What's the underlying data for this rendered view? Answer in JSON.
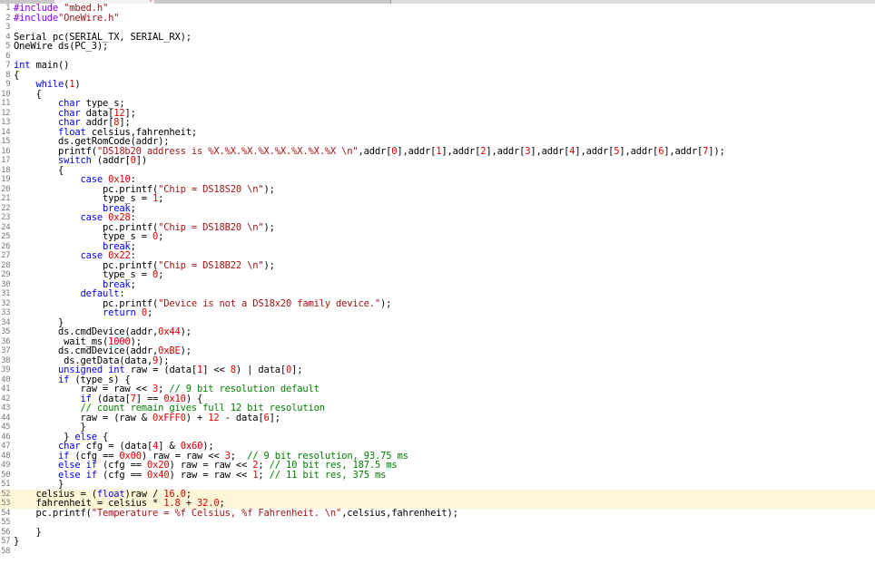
{
  "colors": {
    "keyword": "#0000ff",
    "string": "#a31515",
    "number": "#e00000",
    "comment": "#008000",
    "preprocessor": "#8000ff",
    "line_highlight": "#fff6d8",
    "line_number": "#7a7a7a"
  },
  "tabs": [
    {
      "label": "",
      "active": false
    },
    {
      "label": "",
      "active": true
    },
    {
      "label": "",
      "active": false
    },
    {
      "label": "",
      "active": false
    }
  ],
  "highlighted_lines": [
    52,
    53
  ],
  "lines": [
    {
      "n": "1",
      "fold": "",
      "tokens": [
        [
          "pp",
          "#include "
        ],
        [
          "str",
          "\"mbed.h\""
        ]
      ]
    },
    {
      "n": "2",
      "fold": "",
      "tokens": [
        [
          "pp",
          "#include"
        ],
        [
          "str",
          "\"OneWire.h\""
        ]
      ]
    },
    {
      "n": "3",
      "fold": "",
      "tokens": []
    },
    {
      "n": "4",
      "fold": "",
      "tokens": [
        [
          "t",
          "Serial pc(SERIAL_TX, SERIAL_RX);"
        ]
      ]
    },
    {
      "n": "5",
      "fold": "",
      "tokens": [
        [
          "t",
          "OneWire ds(PC_3);"
        ]
      ]
    },
    {
      "n": "6",
      "fold": "",
      "tokens": []
    },
    {
      "n": "7",
      "fold": "",
      "tokens": [
        [
          "kw",
          "int"
        ],
        [
          "t",
          " main()"
        ]
      ]
    },
    {
      "n": "8",
      "fold": "⊟",
      "tokens": [
        [
          "t",
          "{"
        ]
      ]
    },
    {
      "n": "9",
      "fold": "",
      "tokens": [
        [
          "t",
          "    "
        ],
        [
          "kw",
          "while"
        ],
        [
          "t",
          "("
        ],
        [
          "num",
          "1"
        ],
        [
          "t",
          ")"
        ]
      ]
    },
    {
      "n": "10",
      "fold": "⊟",
      "tokens": [
        [
          "t",
          "    {"
        ]
      ]
    },
    {
      "n": "11",
      "fold": "",
      "tokens": [
        [
          "t",
          "        "
        ],
        [
          "kw",
          "char"
        ],
        [
          "t",
          " type_s;"
        ]
      ]
    },
    {
      "n": "12",
      "fold": "",
      "tokens": [
        [
          "t",
          "        "
        ],
        [
          "kw",
          "char"
        ],
        [
          "t",
          " data["
        ],
        [
          "num",
          "12"
        ],
        [
          "t",
          "];"
        ]
      ]
    },
    {
      "n": "13",
      "fold": "",
      "tokens": [
        [
          "t",
          "        "
        ],
        [
          "kw",
          "char"
        ],
        [
          "t",
          " addr["
        ],
        [
          "num",
          "8"
        ],
        [
          "t",
          "];"
        ]
      ]
    },
    {
      "n": "14",
      "fold": "",
      "tokens": [
        [
          "t",
          "        "
        ],
        [
          "kw",
          "float"
        ],
        [
          "t",
          " celsius,fahrenheit;"
        ]
      ]
    },
    {
      "n": "15",
      "fold": "",
      "tokens": [
        [
          "t",
          "        ds.getRomCode(addr);"
        ]
      ]
    },
    {
      "n": "16",
      "fold": "",
      "tokens": [
        [
          "t",
          "        printf("
        ],
        [
          "str",
          "\"DS18b20 address is %X.%X.%X.%X.%X.%X.%X.%X \\n\""
        ],
        [
          "t",
          ",addr["
        ],
        [
          "num",
          "0"
        ],
        [
          "t",
          "],addr["
        ],
        [
          "num",
          "1"
        ],
        [
          "t",
          "],addr["
        ],
        [
          "num",
          "2"
        ],
        [
          "t",
          "],addr["
        ],
        [
          "num",
          "3"
        ],
        [
          "t",
          "],addr["
        ],
        [
          "num",
          "4"
        ],
        [
          "t",
          "],addr["
        ],
        [
          "num",
          "5"
        ],
        [
          "t",
          "],addr["
        ],
        [
          "num",
          "6"
        ],
        [
          "t",
          "],addr["
        ],
        [
          "num",
          "7"
        ],
        [
          "t",
          "]);"
        ]
      ]
    },
    {
      "n": "17",
      "fold": "",
      "tokens": [
        [
          "t",
          "        "
        ],
        [
          "kw",
          "switch"
        ],
        [
          "t",
          " (addr["
        ],
        [
          "num",
          "0"
        ],
        [
          "t",
          "])"
        ]
      ]
    },
    {
      "n": "18",
      "fold": "⊟",
      "tokens": [
        [
          "t",
          "        {"
        ]
      ]
    },
    {
      "n": "19",
      "fold": "",
      "tokens": [
        [
          "t",
          "            "
        ],
        [
          "kw",
          "case"
        ],
        [
          "t",
          " "
        ],
        [
          "num",
          "0x10"
        ],
        [
          "t",
          ":"
        ]
      ]
    },
    {
      "n": "20",
      "fold": "",
      "tokens": [
        [
          "t",
          "                pc.printf("
        ],
        [
          "str",
          "\"Chip = DS18S20 \\n\""
        ],
        [
          "t",
          ");"
        ]
      ]
    },
    {
      "n": "21",
      "fold": "",
      "tokens": [
        [
          "t",
          "                type_s = "
        ],
        [
          "num",
          "1"
        ],
        [
          "t",
          ";"
        ]
      ]
    },
    {
      "n": "22",
      "fold": "",
      "tokens": [
        [
          "t",
          "                "
        ],
        [
          "kw",
          "break"
        ],
        [
          "t",
          ";"
        ]
      ]
    },
    {
      "n": "23",
      "fold": "",
      "tokens": [
        [
          "t",
          "            "
        ],
        [
          "kw",
          "case"
        ],
        [
          "t",
          " "
        ],
        [
          "num",
          "0x28"
        ],
        [
          "t",
          ":"
        ]
      ]
    },
    {
      "n": "24",
      "fold": "",
      "tokens": [
        [
          "t",
          "                pc.printf("
        ],
        [
          "str",
          "\"Chip = DS18B20 \\n\""
        ],
        [
          "t",
          ");"
        ]
      ]
    },
    {
      "n": "25",
      "fold": "",
      "tokens": [
        [
          "t",
          "                type_s = "
        ],
        [
          "num",
          "0"
        ],
        [
          "t",
          ";"
        ]
      ]
    },
    {
      "n": "26",
      "fold": "",
      "tokens": [
        [
          "t",
          "                "
        ],
        [
          "kw",
          "break"
        ],
        [
          "t",
          ";"
        ]
      ]
    },
    {
      "n": "27",
      "fold": "",
      "tokens": [
        [
          "t",
          "            "
        ],
        [
          "kw",
          "case"
        ],
        [
          "t",
          " "
        ],
        [
          "num",
          "0x22"
        ],
        [
          "t",
          ":"
        ]
      ]
    },
    {
      "n": "28",
      "fold": "",
      "tokens": [
        [
          "t",
          "                pc.printf("
        ],
        [
          "str",
          "\"Chip = DS18B22 \\n\""
        ],
        [
          "t",
          ");"
        ]
      ]
    },
    {
      "n": "29",
      "fold": "",
      "tokens": [
        [
          "t",
          "                type_s = "
        ],
        [
          "num",
          "0"
        ],
        [
          "t",
          ";"
        ]
      ]
    },
    {
      "n": "30",
      "fold": "",
      "tokens": [
        [
          "t",
          "                "
        ],
        [
          "kw",
          "break"
        ],
        [
          "t",
          ";"
        ]
      ]
    },
    {
      "n": "31",
      "fold": "",
      "tokens": [
        [
          "t",
          "            "
        ],
        [
          "kw",
          "default"
        ],
        [
          "t",
          ":"
        ]
      ]
    },
    {
      "n": "32",
      "fold": "",
      "tokens": [
        [
          "t",
          "                pc.printf("
        ],
        [
          "str",
          "\"Device is not a DS18x20 family device.\""
        ],
        [
          "t",
          ");"
        ]
      ]
    },
    {
      "n": "33",
      "fold": "",
      "tokens": [
        [
          "t",
          "                "
        ],
        [
          "kw",
          "return"
        ],
        [
          "t",
          " "
        ],
        [
          "num",
          "0"
        ],
        [
          "t",
          ";"
        ]
      ]
    },
    {
      "n": "34",
      "fold": "",
      "tokens": [
        [
          "t",
          "        }"
        ]
      ]
    },
    {
      "n": "35",
      "fold": "",
      "tokens": [
        [
          "t",
          "        ds.cmdDevice(addr,"
        ],
        [
          "num",
          "0x44"
        ],
        [
          "t",
          ");"
        ]
      ]
    },
    {
      "n": "36",
      "fold": "",
      "tokens": [
        [
          "t",
          "         wait_ms("
        ],
        [
          "num",
          "1000"
        ],
        [
          "t",
          ");"
        ]
      ]
    },
    {
      "n": "37",
      "fold": "",
      "tokens": [
        [
          "t",
          "        ds.cmdDevice(addr,"
        ],
        [
          "num",
          "0xBE"
        ],
        [
          "t",
          ");"
        ]
      ]
    },
    {
      "n": "38",
      "fold": "",
      "tokens": [
        [
          "t",
          "         ds.getData(data,"
        ],
        [
          "num",
          "9"
        ],
        [
          "t",
          ");"
        ]
      ]
    },
    {
      "n": "39",
      "fold": "",
      "tokens": [
        [
          "t",
          "        "
        ],
        [
          "kw",
          "unsigned"
        ],
        [
          "t",
          " "
        ],
        [
          "kw",
          "int"
        ],
        [
          "t",
          " raw = (data["
        ],
        [
          "num",
          "1"
        ],
        [
          "t",
          "] << "
        ],
        [
          "num",
          "8"
        ],
        [
          "t",
          ") | data["
        ],
        [
          "num",
          "0"
        ],
        [
          "t",
          "];"
        ]
      ]
    },
    {
      "n": "40",
      "fold": "",
      "tokens": [
        [
          "t",
          "        "
        ],
        [
          "kw",
          "if"
        ],
        [
          "t",
          " (type_s) {"
        ]
      ]
    },
    {
      "n": "41",
      "fold": "",
      "tokens": [
        [
          "t",
          "            raw = raw << "
        ],
        [
          "num",
          "3"
        ],
        [
          "t",
          "; "
        ],
        [
          "cmt",
          "// 9 bit resolution default"
        ]
      ]
    },
    {
      "n": "42",
      "fold": "",
      "tokens": [
        [
          "t",
          "            "
        ],
        [
          "kw",
          "if"
        ],
        [
          "t",
          " (data["
        ],
        [
          "num",
          "7"
        ],
        [
          "t",
          "] == "
        ],
        [
          "num",
          "0x10"
        ],
        [
          "t",
          ") {"
        ]
      ]
    },
    {
      "n": "43",
      "fold": "",
      "tokens": [
        [
          "t",
          "            "
        ],
        [
          "cmt",
          "// count remain gives full 12 bit resolution"
        ]
      ]
    },
    {
      "n": "44",
      "fold": "",
      "tokens": [
        [
          "t",
          "            raw = (raw & "
        ],
        [
          "num",
          "0xFFF0"
        ],
        [
          "t",
          ") + "
        ],
        [
          "num",
          "12"
        ],
        [
          "t",
          " - data["
        ],
        [
          "num",
          "6"
        ],
        [
          "t",
          "];"
        ]
      ]
    },
    {
      "n": "45",
      "fold": "",
      "tokens": [
        [
          "t",
          "            }"
        ]
      ]
    },
    {
      "n": "46",
      "fold": "",
      "tokens": [
        [
          "t",
          "         } "
        ],
        [
          "kw",
          "else"
        ],
        [
          "t",
          " {"
        ]
      ]
    },
    {
      "n": "47",
      "fold": "",
      "tokens": [
        [
          "t",
          "        "
        ],
        [
          "kw",
          "char"
        ],
        [
          "t",
          " cfg = (data["
        ],
        [
          "num",
          "4"
        ],
        [
          "t",
          "] & "
        ],
        [
          "num",
          "0x60"
        ],
        [
          "t",
          ");"
        ]
      ]
    },
    {
      "n": "48",
      "fold": "",
      "tokens": [
        [
          "t",
          "        "
        ],
        [
          "kw",
          "if"
        ],
        [
          "t",
          " (cfg == "
        ],
        [
          "num",
          "0x00"
        ],
        [
          "t",
          ") raw = raw << "
        ],
        [
          "num",
          "3"
        ],
        [
          "t",
          ";  "
        ],
        [
          "cmt",
          "// 9 bit resolution, 93.75 ms"
        ]
      ]
    },
    {
      "n": "49",
      "fold": "",
      "tokens": [
        [
          "t",
          "        "
        ],
        [
          "kw",
          "else"
        ],
        [
          "t",
          " "
        ],
        [
          "kw",
          "if"
        ],
        [
          "t",
          " (cfg == "
        ],
        [
          "num",
          "0x20"
        ],
        [
          "t",
          ") raw = raw << "
        ],
        [
          "num",
          "2"
        ],
        [
          "t",
          "; "
        ],
        [
          "cmt",
          "// 10 bit res, 187.5 ms"
        ]
      ]
    },
    {
      "n": "50",
      "fold": "",
      "tokens": [
        [
          "t",
          "        "
        ],
        [
          "kw",
          "else"
        ],
        [
          "t",
          " "
        ],
        [
          "kw",
          "if"
        ],
        [
          "t",
          " (cfg == "
        ],
        [
          "num",
          "0x40"
        ],
        [
          "t",
          ") raw = raw << "
        ],
        [
          "num",
          "1"
        ],
        [
          "t",
          "; "
        ],
        [
          "cmt",
          "// 11 bit res, 375 ms"
        ]
      ]
    },
    {
      "n": "51",
      "fold": "",
      "tokens": [
        [
          "t",
          "        }"
        ]
      ]
    },
    {
      "n": "52",
      "fold": "",
      "tokens": [
        [
          "t",
          "    celsius = ("
        ],
        [
          "kw",
          "float"
        ],
        [
          "t",
          ")raw / "
        ],
        [
          "num",
          "16.0"
        ],
        [
          "t",
          ";"
        ]
      ]
    },
    {
      "n": "53",
      "fold": "",
      "tokens": [
        [
          "t",
          "    fahrenheit = celsius * "
        ],
        [
          "num",
          "1.8"
        ],
        [
          "t",
          " + "
        ],
        [
          "num",
          "32.0"
        ],
        [
          "t",
          ";"
        ]
      ]
    },
    {
      "n": "54",
      "fold": "",
      "tokens": [
        [
          "t",
          "    pc.printf("
        ],
        [
          "str",
          "\"Temperature = %f Celsius, %f Fahrenheit. \\n\""
        ],
        [
          "t",
          ",celsius,fahrenheit);"
        ]
      ]
    },
    {
      "n": "55",
      "fold": "",
      "tokens": []
    },
    {
      "n": "56",
      "fold": "",
      "tokens": [
        [
          "t",
          "    }"
        ]
      ]
    },
    {
      "n": "57",
      "fold": "",
      "tokens": [
        [
          "t",
          "}"
        ]
      ]
    },
    {
      "n": "58",
      "fold": "",
      "tokens": []
    }
  ]
}
